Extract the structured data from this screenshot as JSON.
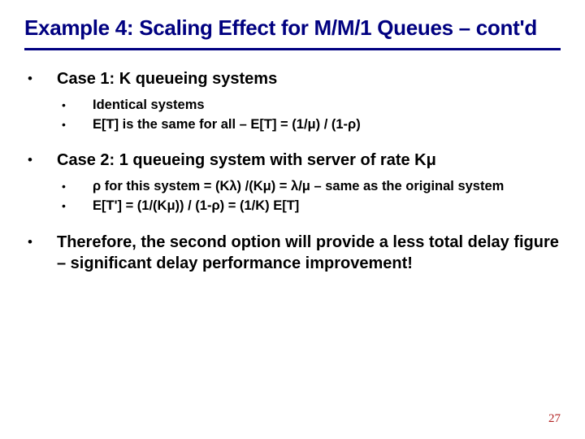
{
  "title": "Example 4: Scaling Effect for M/M/1 Queues – cont'd",
  "bullets": [
    {
      "head": "Case 1: K queueing systems",
      "sub": [
        "Identical systems",
        "E[T] is the same for all – E[T] = (1/μ) / (1-ρ)"
      ]
    },
    {
      "head": "Case 2: 1 queueing system with server of rate Kμ",
      "sub": [
        " ρ for this system = (Kλ) /(Kμ) = λ/μ – same as the original system",
        "E[T'] = (1/(Kμ)) / (1-ρ) = (1/K) E[T]"
      ]
    },
    {
      "head": "Therefore, the second option will provide a less total delay figure – significant delay performance improvement!",
      "sub": []
    }
  ],
  "page_number": "27"
}
